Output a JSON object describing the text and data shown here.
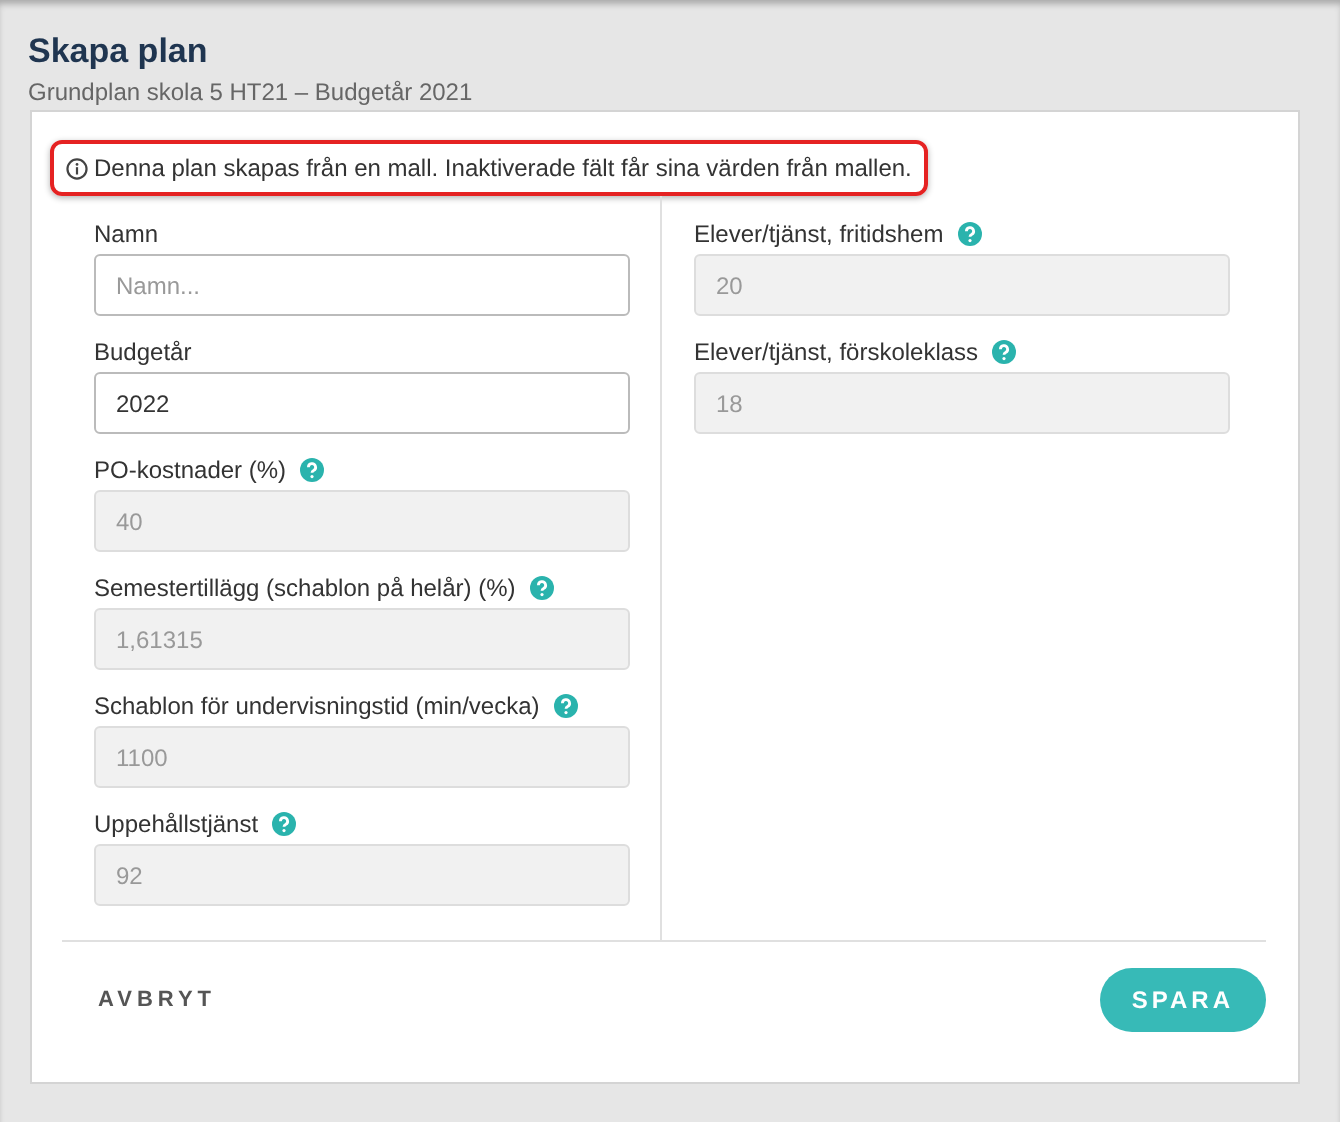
{
  "header": {
    "title": "Skapa plan",
    "subtitle": "Grundplan skola 5 HT21 – Budgetår 2021"
  },
  "notice": {
    "text": "Denna plan skapas från en mall. Inaktiverade fält får sina värden från mallen.",
    "highlighted": true
  },
  "left_fields": [
    {
      "label": "Namn",
      "placeholder": "Namn...",
      "disabled": false,
      "help": false
    },
    {
      "label": "Budgetår",
      "value": "2022",
      "disabled": false,
      "help": false
    },
    {
      "label": "PO-kostnader (%)",
      "value": "40",
      "disabled": true,
      "help": true
    },
    {
      "label": "Semestertillägg (schablon på helår) (%)",
      "value": "1,61315",
      "disabled": true,
      "help": true
    },
    {
      "label": "Schablon för undervisningstid (min/vecka)",
      "value": "1100",
      "disabled": true,
      "help": true
    },
    {
      "label": "Uppehållstjänst",
      "value": "92",
      "disabled": true,
      "help": true
    }
  ],
  "right_fields": [
    {
      "label": "Elever/tjänst, fritidshem",
      "value": "20",
      "disabled": true,
      "help": true
    },
    {
      "label": "Elever/tjänst, förskoleklass",
      "value": "18",
      "disabled": true,
      "help": true
    }
  ],
  "buttons": [
    {
      "label": "AVBRYT",
      "kind": "text"
    },
    {
      "label": "SPARA",
      "kind": "primary"
    }
  ]
}
